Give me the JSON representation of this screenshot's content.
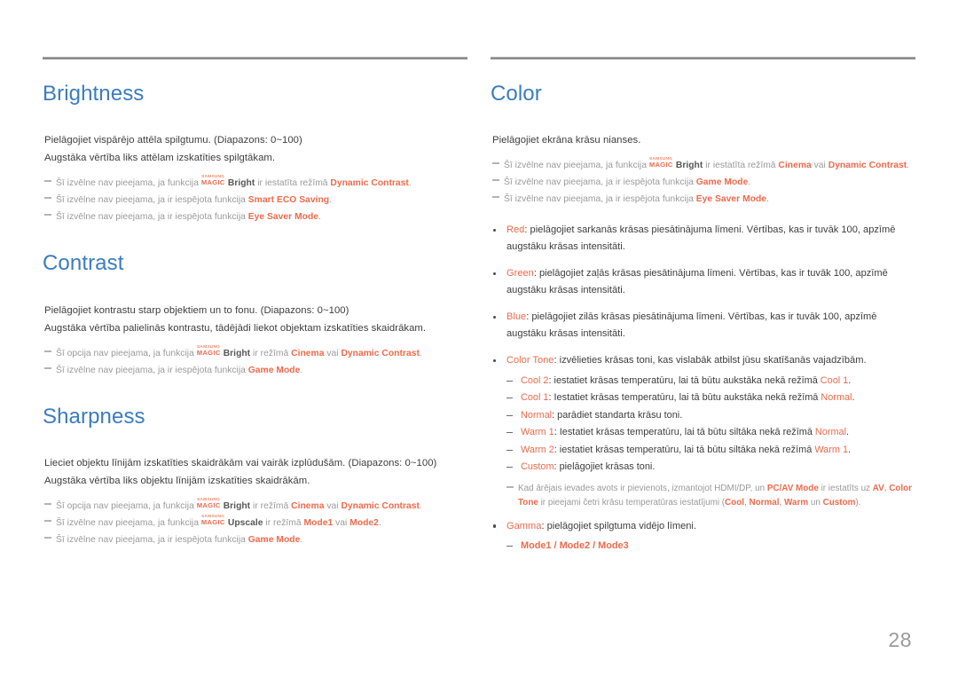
{
  "page": {
    "number": "28"
  },
  "colors": {
    "heading": "#3b7cc0",
    "accent": "#ef6a4b",
    "note": "#9a9a9a",
    "body": "#3d3d3d"
  },
  "left": {
    "brightness": {
      "title": "Brightness",
      "p1": "Pielāgojiet vispārējo attēla spilgtumu. (Diapazons: 0~100)",
      "p2": "Augstāka vērtība liks attēlam izskatīties spilgtākam.",
      "note1_a": "Šī izvēlne nav pieejama, ja funkcija ",
      "note1_magic_sam": "SAMSUNG",
      "note1_magic_mgc": "MAGIC",
      "note1_magic_word": "Bright",
      "note1_b": " ir iestatīta režīmā ",
      "note1_hl": "Dynamic Contrast",
      "note1_c": ".",
      "note2_a": "Šī izvēlne nav pieejama, ja ir iespējota funkcija ",
      "note2_hl": "Smart ECO Saving",
      "note2_b": ".",
      "note3_a": "Šī izvēlne nav pieejama, ja ir iespējota funkcija ",
      "note3_hl": "Eye Saver Mode",
      "note3_b": "."
    },
    "contrast": {
      "title": "Contrast",
      "p1": "Pielāgojiet kontrastu starp objektiem un to fonu. (Diapazons: 0~100)",
      "p2": "Augstāka vērtība palielinās kontrastu, tādējādi liekot objektam izskatīties skaidrākam.",
      "note1_a": "Šī opcija nav pieejama, ja funkcija ",
      "note1_magic_sam": "SAMSUNG",
      "note1_magic_mgc": "MAGIC",
      "note1_magic_word": "Bright",
      "note1_b": " ir režīmā ",
      "note1_hl1": "Cinema",
      "note1_c": " vai ",
      "note1_hl2": "Dynamic Contrast",
      "note1_d": ".",
      "note2_a": "Šī izvēlne nav pieejama, ja ir iespējota funkcija ",
      "note2_hl": "Game Mode",
      "note2_b": "."
    },
    "sharpness": {
      "title": "Sharpness",
      "p1": "Lieciet objektu līnijām izskatīties skaidrākām vai vairāk izplūdušām. (Diapazons: 0~100)",
      "p2": "Augstāka vērtība liks objektu līnijām izskatīties skaidrākām.",
      "note1_a": "Šī opcija nav pieejama, ja funkcija ",
      "note1_magic_sam": "SAMSUNG",
      "note1_magic_mgc": "MAGIC",
      "note1_magic_word": "Bright",
      "note1_b": " ir režīmā ",
      "note1_hl1": "Cinema",
      "note1_c": " vai ",
      "note1_hl2": "Dynamic Contrast",
      "note1_d": ".",
      "note2_a": "Šī izvēlne nav pieejama, ja funkcija ",
      "note2_magic_sam": "SAMSUNG",
      "note2_magic_mgc": "MAGIC",
      "note2_magic_word": "Upscale",
      "note2_b": " ir režīmā ",
      "note2_hl1": "Mode1",
      "note2_c": " vai ",
      "note2_hl2": "Mode2",
      "note2_d": ".",
      "note3_a": "Šī izvēlne nav pieejama, ja ir iespējota funkcija ",
      "note3_hl": "Game Mode",
      "note3_b": "."
    }
  },
  "right": {
    "color": {
      "title": "Color",
      "p1": "Pielāgojiet ekrāna krāsu nianses.",
      "note1_a": "Šī izvēlne nav pieejama, ja funkcija ",
      "note1_magic_sam": "SAMSUNG",
      "note1_magic_mgc": "MAGIC",
      "note1_magic_word": "Bright",
      "note1_b": " ir iestatīta režīmā ",
      "note1_hl1": "Cinema",
      "note1_c": " vai ",
      "note1_hl2": "Dynamic Contrast",
      "note1_d": ".",
      "note2_a": "Šī izvēlne nav pieejama, ja ir iespējota funkcija ",
      "note2_hl": "Game Mode",
      "note2_b": ".",
      "note3_a": "Šī izvēlne nav pieejama, ja ir iespējota funkcija ",
      "note3_hl": "Eye Saver Mode",
      "note3_b": ".",
      "bullet_red_label": "Red",
      "bullet_red_text": ": pielāgojiet sarkanās krāsas piesātinājuma līmeni. Vērtības, kas ir tuvāk 100, apzīmē augstāku krāsas intensitāti.",
      "bullet_green_label": "Green",
      "bullet_green_text": ": pielāgojiet zaļās krāsas piesātinājuma līmeni. Vērtības, kas ir tuvāk 100, apzīmē augstāku krāsas intensitāti.",
      "bullet_blue_label": "Blue",
      "bullet_blue_text": ": pielāgojiet zilās krāsas piesātinājuma līmeni. Vērtības, kas ir tuvāk 100, apzīmē augstāku krāsas intensitāti.",
      "bullet_tone_label": "Color Tone",
      "bullet_tone_text": ": izvēlieties krāsas toni, kas vislabāk atbilst jūsu skatīšanās vajadzībām.",
      "tone_cool2_label": "Cool 2",
      "tone_cool2_a": ": iestatiet krāsas temperatūru, lai tā būtu aukstāka nekā režīmā ",
      "tone_cool2_ref": "Cool 1",
      "tone_cool2_b": ".",
      "tone_cool1_label": "Cool 1",
      "tone_cool1_a": ": Iestatiet krāsas temperatūru, lai tā būtu aukstāka nekā režīmā ",
      "tone_cool1_ref": "Normal",
      "tone_cool1_b": ".",
      "tone_normal_label": "Normal",
      "tone_normal_a": ": parādiet standarta krāsu toni.",
      "tone_warm1_label": "Warm 1",
      "tone_warm1_a": ": Iestatiet krāsas temperatūru, lai tā būtu siltāka nekā režīmā ",
      "tone_warm1_ref": "Normal",
      "tone_warm1_b": ".",
      "tone_warm2_label": "Warm 2",
      "tone_warm2_a": ": iestatiet krāsas temperatūru, lai tā būtu siltāka nekā režīmā ",
      "tone_warm2_ref": "Warm 1",
      "tone_warm2_b": ".",
      "tone_custom_label": "Custom",
      "tone_custom_a": ": pielāgojiet krāsas toni.",
      "hdmi_note_a": "Kad ārējais ievades avots ir pievienots, izmantojot HDMI/DP, un ",
      "hdmi_note_hl1": "PC/AV Mode",
      "hdmi_note_b": " ir iestatīts uz ",
      "hdmi_note_hl2": "AV",
      "hdmi_note_c": ", ",
      "hdmi_note_hl3": "Color Tone",
      "hdmi_note_d": " ir pieejami četri krāsu temperatūras iestatījumi (",
      "hdmi_note_hl4": "Cool",
      "hdmi_note_e": ", ",
      "hdmi_note_hl5": "Normal",
      "hdmi_note_f": ", ",
      "hdmi_note_hl6": "Warm",
      "hdmi_note_g": " un ",
      "hdmi_note_hl7": "Custom",
      "hdmi_note_h": ").",
      "bullet_gamma_label": "Gamma",
      "bullet_gamma_text": ": pielāgojiet spilgtuma vidējo līmeni.",
      "gamma_modes": "Mode1 / Mode2 / Mode3"
    }
  }
}
